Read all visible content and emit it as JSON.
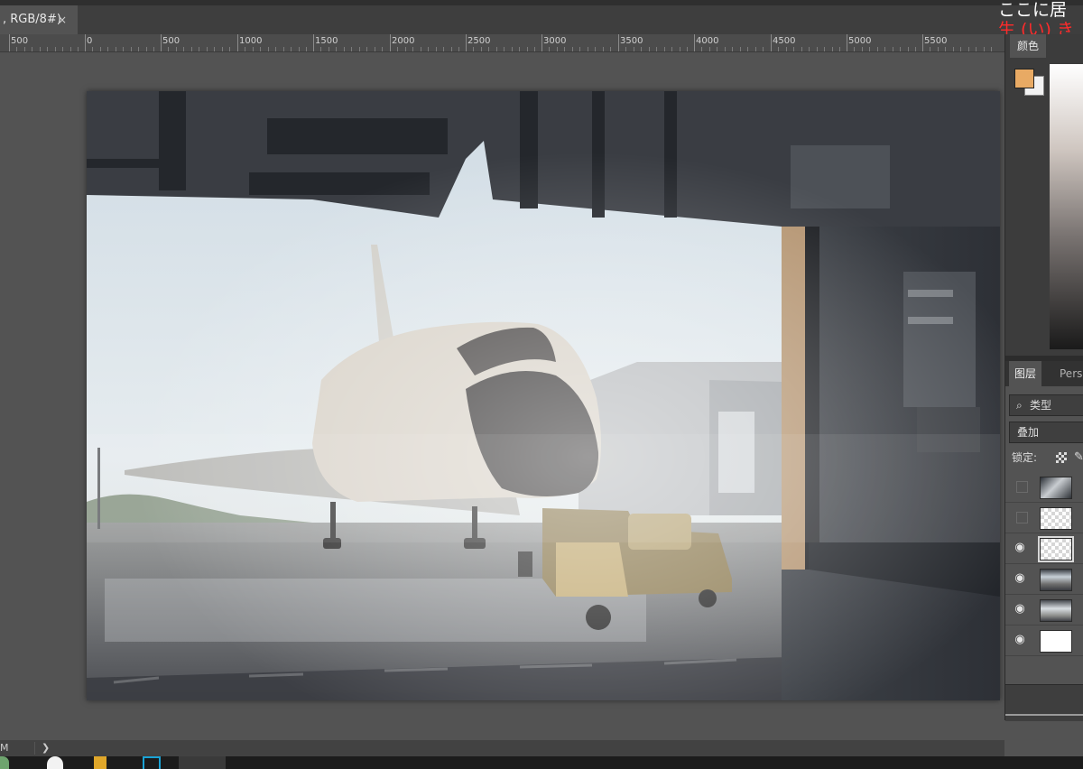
{
  "document_tab": {
    "title": ", RGB/8#)",
    "close_symbol": "×"
  },
  "overlay_text": {
    "line1": "ここに居",
    "line2": "生 (い) き"
  },
  "ruler": {
    "labels": [
      "500",
      "0",
      "500",
      "1000",
      "1500",
      "2000",
      "2500",
      "3000",
      "3500",
      "4000",
      "4500",
      "5000",
      "5500"
    ]
  },
  "color_panel": {
    "tab_label": "颜色",
    "foreground_color": "#e8aa64",
    "background_color": "#f2f2f2"
  },
  "layers_panel": {
    "tabs": [
      "图层",
      "Persp"
    ],
    "filter": {
      "icon": "search-icon",
      "label": "类型"
    },
    "blend_mode": "叠加",
    "lock_label": "锁定:",
    "layers": [
      {
        "visible": false,
        "thumb": "photo-reference"
      },
      {
        "visible": false,
        "thumb": "transparent"
      },
      {
        "visible": true,
        "thumb": "transparent",
        "selected": true
      },
      {
        "visible": true,
        "thumb": "painting"
      },
      {
        "visible": true,
        "thumb": "painting-small"
      },
      {
        "visible": true,
        "thumb": "white"
      }
    ]
  },
  "status_bar": {
    "zoom": "M",
    "chevron": "❯"
  },
  "icons": {
    "eye": "eye-icon",
    "close": "close-icon",
    "lock_transparent": "lock-transparent-pixels-icon",
    "lock_brush": "lock-image-pixels-icon"
  }
}
